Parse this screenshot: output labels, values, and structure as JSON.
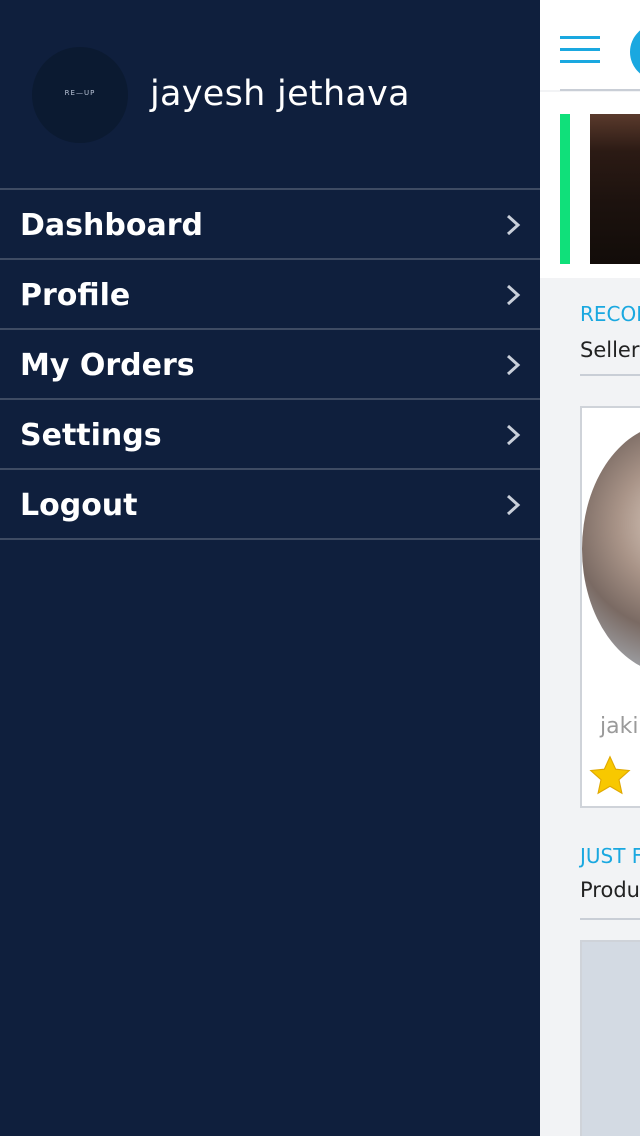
{
  "drawer": {
    "user_name": "jayesh jethava",
    "avatar_logo_text": "RE—UP",
    "menu": [
      {
        "label": "Dashboard",
        "icon": "chevron-right-icon"
      },
      {
        "label": "Profile",
        "icon": "chevron-right-icon"
      },
      {
        "label": "My Orders",
        "icon": "chevron-right-icon"
      },
      {
        "label": "Settings",
        "icon": "chevron-right-icon"
      },
      {
        "label": "Logout",
        "icon": "chevron-right-icon"
      }
    ]
  },
  "main": {
    "section1": {
      "title": "RECOI",
      "subtitle": "Seller"
    },
    "seller_card": {
      "name": "jaki"
    },
    "section2": {
      "title": "JUST F",
      "subtitle": "Produ"
    }
  },
  "colors": {
    "drawer_bg": "#0f1f3d",
    "accent": "#1aa8e0",
    "green_indicator": "#10e07a",
    "star": "#f8c800"
  }
}
